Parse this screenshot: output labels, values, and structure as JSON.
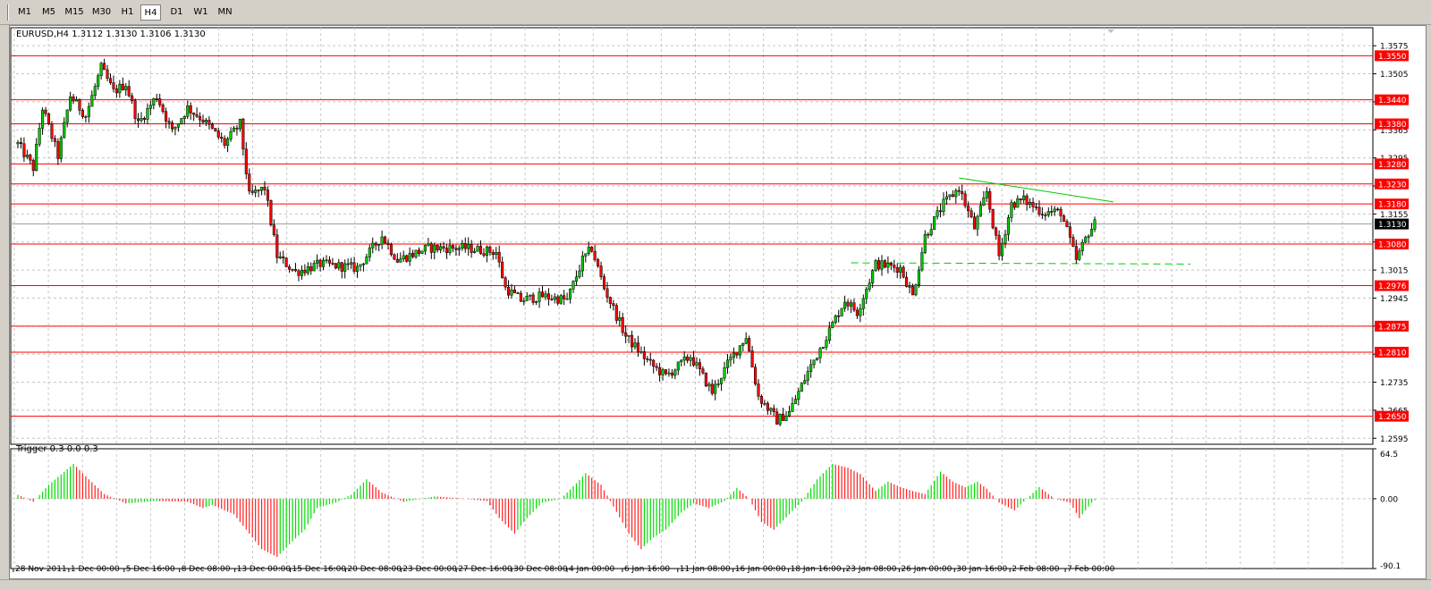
{
  "timeframes": [
    "M1",
    "M5",
    "M15",
    "M30",
    "H1",
    "H4",
    "D1",
    "W1",
    "MN"
  ],
  "active_timeframe": "H4",
  "chart_header": "EURUSD,H4  1.3112 1.3130 1.3106 1.3130",
  "indicator_header": "Trigger 0.3 0.0 0.3",
  "colors": {
    "bull": "#00cc00",
    "bear": "#ff0000",
    "level": "#ff0000",
    "trend": "#00cc00",
    "grid": "#c8c8c8",
    "up_hist": "#00dd00",
    "down_hist": "#ff2020"
  },
  "chart_data": [
    {
      "type": "candlestick",
      "symbol": "EURUSD",
      "timeframe": "H4",
      "ohlc_last": {
        "open": 1.3112,
        "high": 1.313,
        "low": 1.3106,
        "close": 1.313
      },
      "ylim": [
        1.258,
        1.362
      ],
      "y_ticks": [
        "1.3575",
        "1.3505",
        "1.3435",
        "1.3365",
        "1.3295",
        "1.3225",
        "1.3155",
        "1.3085",
        "1.3015",
        "1.2945",
        "1.2875",
        "1.2805",
        "1.2735",
        "1.2665",
        "1.2595"
      ],
      "x_tick_labels": [
        "28 Nov 2011",
        "1 Dec 00:00",
        "5 Dec 16:00",
        "8 Dec 08:00",
        "13 Dec 00:00",
        "15 Dec 16:00",
        "20 Dec 08:00",
        "23 Dec 00:00",
        "27 Dec 16:00",
        "30 Dec 08:00",
        "4 Jan 00:00",
        "6 Jan 16:00",
        "11 Jan 08:00",
        "16 Jan 00:00",
        "18 Jan 16:00",
        "23 Jan 08:00",
        "26 Jan 00:00",
        "30 Jan 16:00",
        "2 Feb 08:00",
        "7 Feb 00:00"
      ],
      "levels": [
        {
          "price": 1.355,
          "label": "1.3550"
        },
        {
          "price": 1.344,
          "label": "1.3440"
        },
        {
          "price": 1.338,
          "label": "1.3380"
        },
        {
          "price": 1.328,
          "label": "1.3280"
        },
        {
          "price": 1.323,
          "label": "1.3230"
        },
        {
          "price": 1.318,
          "label": "1.3180"
        },
        {
          "price": 1.308,
          "label": "1.3080"
        },
        {
          "price": 1.2976,
          "label": "1.2976"
        },
        {
          "price": 1.2875,
          "label": "1.2875"
        },
        {
          "price": 1.281,
          "label": "1.2810"
        },
        {
          "price": 1.265,
          "label": "1.2650"
        }
      ],
      "current_price": {
        "price": 1.313,
        "label": "1.3130"
      },
      "trendlines": [
        {
          "style": "solid",
          "from": {
            "bar": 305,
            "price": 1.3245
          },
          "to": {
            "bar": 355,
            "price": 1.3185
          }
        },
        {
          "style": "dashed",
          "from": {
            "bar": 270,
            "price": 1.3033
          },
          "to": {
            "bar": 380,
            "price": 1.303
          }
        }
      ],
      "anchors": [
        [
          0,
          1.333
        ],
        [
          5,
          1.327
        ],
        [
          8,
          1.342
        ],
        [
          13,
          1.33
        ],
        [
          17,
          1.345
        ],
        [
          22,
          1.34
        ],
        [
          27,
          1.352
        ],
        [
          31,
          1.346
        ],
        [
          35,
          1.348
        ],
        [
          39,
          1.338
        ],
        [
          45,
          1.345
        ],
        [
          50,
          1.336
        ],
        [
          55,
          1.342
        ],
        [
          60,
          1.339
        ],
        [
          67,
          1.333
        ],
        [
          72,
          1.338
        ],
        [
          75,
          1.32
        ],
        [
          80,
          1.322
        ],
        [
          84,
          1.305
        ],
        [
          90,
          1.301
        ],
        [
          98,
          1.303
        ],
        [
          110,
          1.302
        ],
        [
          118,
          1.31
        ],
        [
          123,
          1.304
        ],
        [
          133,
          1.307
        ],
        [
          145,
          1.307
        ],
        [
          155,
          1.306
        ],
        [
          158,
          1.297
        ],
        [
          163,
          1.294
        ],
        [
          170,
          1.295
        ],
        [
          178,
          1.294
        ],
        [
          183,
          1.304
        ],
        [
          186,
          1.307
        ],
        [
          190,
          1.297
        ],
        [
          197,
          1.285
        ],
        [
          205,
          1.278
        ],
        [
          210,
          1.275
        ],
        [
          218,
          1.28
        ],
        [
          225,
          1.271
        ],
        [
          230,
          1.278
        ],
        [
          236,
          1.285
        ],
        [
          240,
          1.27
        ],
        [
          246,
          1.264
        ],
        [
          250,
          1.266
        ],
        [
          256,
          1.276
        ],
        [
          262,
          1.285
        ],
        [
          268,
          1.294
        ],
        [
          272,
          1.291
        ],
        [
          278,
          1.303
        ],
        [
          286,
          1.302
        ],
        [
          290,
          1.295
        ],
        [
          294,
          1.31
        ],
        [
          300,
          1.318
        ],
        [
          305,
          1.322
        ],
        [
          310,
          1.312
        ],
        [
          314,
          1.321
        ],
        [
          318,
          1.305
        ],
        [
          322,
          1.318
        ],
        [
          326,
          1.319
        ],
        [
          332,
          1.316
        ],
        [
          338,
          1.316
        ],
        [
          343,
          1.304
        ],
        [
          347,
          1.311
        ],
        [
          349,
          1.313
        ]
      ]
    },
    {
      "type": "bar",
      "name": "Trigger",
      "params": "0.3 0.0 0.3",
      "ylim": [
        -90.1,
        64.5
      ],
      "y_ticks": [
        "64.5",
        "0.00",
        "-90.1"
      ],
      "anchors": [
        [
          0,
          5
        ],
        [
          5,
          -4
        ],
        [
          10,
          18
        ],
        [
          18,
          45
        ],
        [
          23,
          25
        ],
        [
          28,
          6
        ],
        [
          35,
          -6
        ],
        [
          45,
          -3
        ],
        [
          55,
          -4
        ],
        [
          60,
          -12
        ],
        [
          63,
          -8
        ],
        [
          70,
          -20
        ],
        [
          75,
          -45
        ],
        [
          79,
          -65
        ],
        [
          84,
          -75
        ],
        [
          89,
          -55
        ],
        [
          93,
          -40
        ],
        [
          97,
          -12
        ],
        [
          103,
          -5
        ],
        [
          108,
          5
        ],
        [
          113,
          25
        ],
        [
          118,
          8
        ],
        [
          125,
          -4
        ],
        [
          135,
          3
        ],
        [
          145,
          0
        ],
        [
          152,
          -3
        ],
        [
          156,
          -25
        ],
        [
          161,
          -45
        ],
        [
          165,
          -25
        ],
        [
          170,
          -5
        ],
        [
          176,
          0
        ],
        [
          181,
          20
        ],
        [
          184,
          33
        ],
        [
          189,
          18
        ],
        [
          193,
          -10
        ],
        [
          198,
          -45
        ],
        [
          202,
          -65
        ],
        [
          206,
          -50
        ],
        [
          210,
          -40
        ],
        [
          215,
          -18
        ],
        [
          219,
          -6
        ],
        [
          224,
          -12
        ],
        [
          229,
          -3
        ],
        [
          233,
          14
        ],
        [
          237,
          0
        ],
        [
          241,
          -30
        ],
        [
          245,
          -40
        ],
        [
          250,
          -20
        ],
        [
          254,
          -4
        ],
        [
          259,
          25
        ],
        [
          264,
          45
        ],
        [
          269,
          40
        ],
        [
          273,
          32
        ],
        [
          278,
          10
        ],
        [
          282,
          22
        ],
        [
          286,
          15
        ],
        [
          290,
          10
        ],
        [
          294,
          6
        ],
        [
          299,
          35
        ],
        [
          303,
          22
        ],
        [
          307,
          15
        ],
        [
          311,
          22
        ],
        [
          314,
          13
        ],
        [
          318,
          -5
        ],
        [
          323,
          -15
        ],
        [
          327,
          0
        ],
        [
          331,
          15
        ],
        [
          336,
          0
        ],
        [
          341,
          -5
        ],
        [
          344,
          -25
        ],
        [
          348,
          -5
        ],
        [
          349,
          -2
        ]
      ]
    }
  ]
}
